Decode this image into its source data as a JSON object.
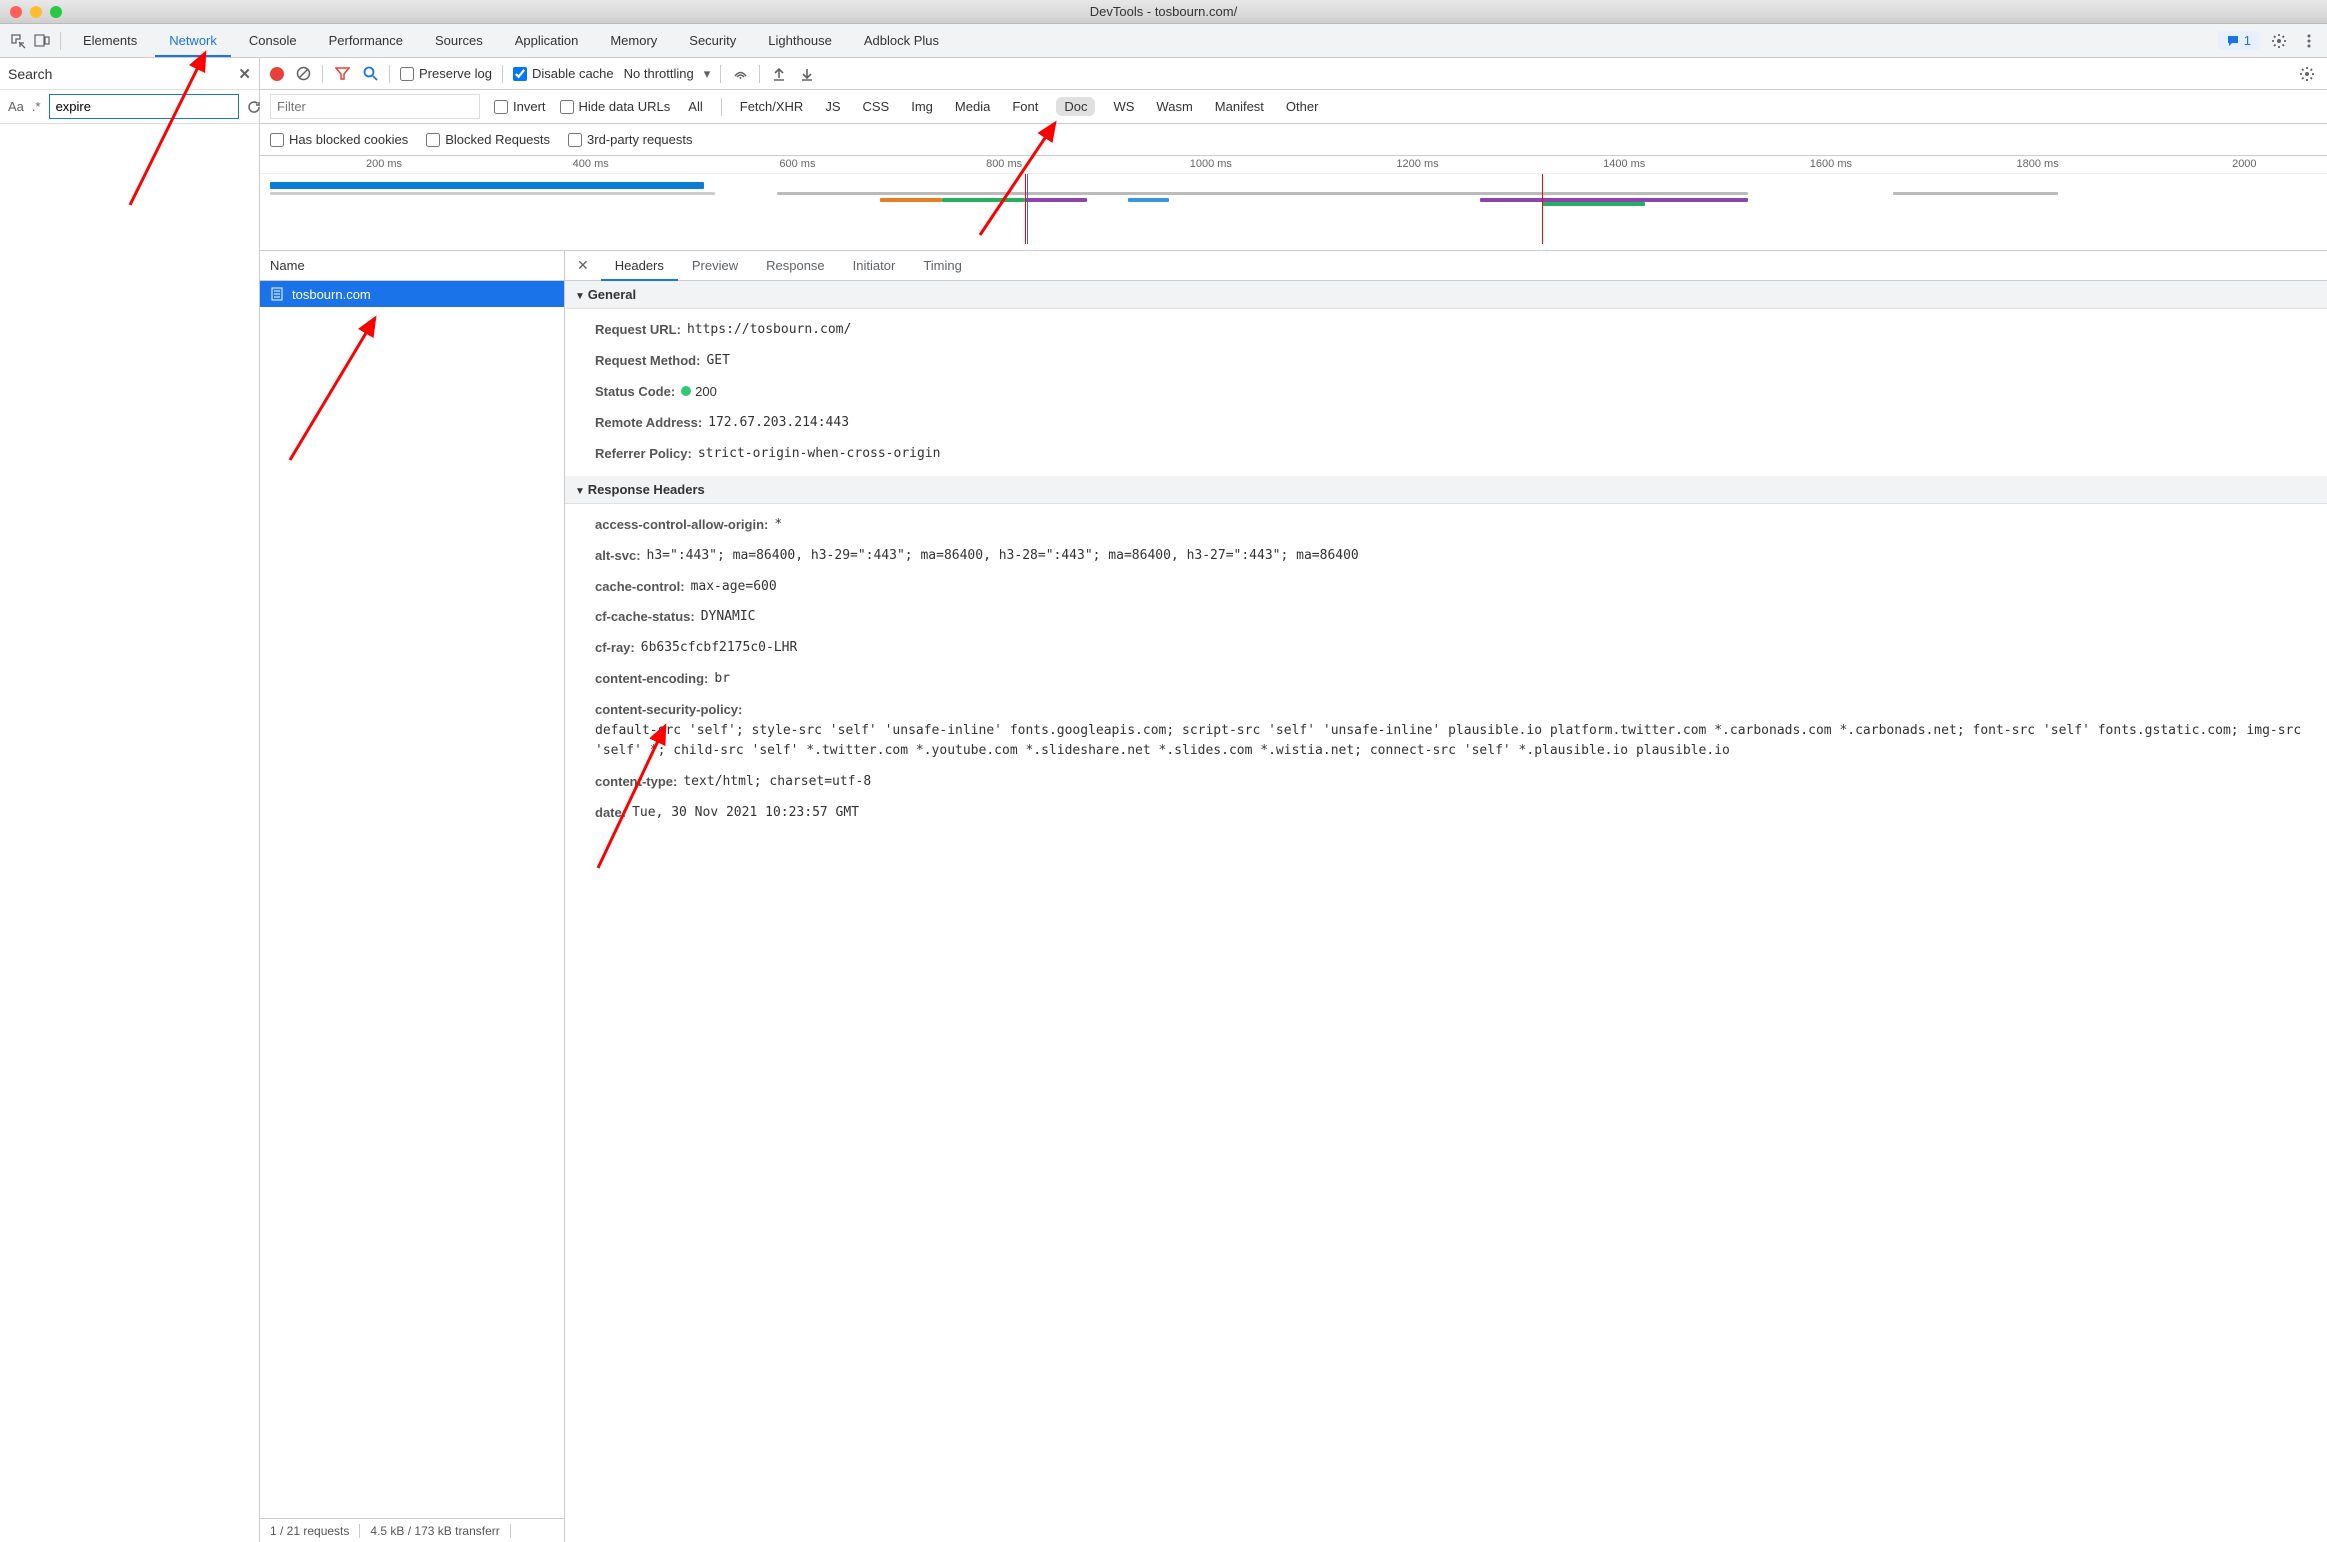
{
  "window": {
    "title": "DevTools - tosbourn.com/"
  },
  "mainTabs": {
    "elements": "Elements",
    "network": "Network",
    "console": "Console",
    "performance": "Performance",
    "sources": "Sources",
    "application": "Application",
    "memory": "Memory",
    "security": "Security",
    "lighthouse": "Lighthouse",
    "adblock": "Adblock Plus"
  },
  "issuesCount": "1",
  "searchPanel": {
    "title": "Search",
    "aa": "Aa",
    "regex": ".*",
    "value": "expire"
  },
  "networkToolbar": {
    "preserveLog": "Preserve log",
    "disableCache": "Disable cache",
    "throttling": "No throttling"
  },
  "filterBar": {
    "placeholder": "Filter",
    "invert": "Invert",
    "hideDataUrls": "Hide data URLs",
    "types": {
      "all": "All",
      "fetchxhr": "Fetch/XHR",
      "js": "JS",
      "css": "CSS",
      "img": "Img",
      "media": "Media",
      "font": "Font",
      "doc": "Doc",
      "ws": "WS",
      "wasm": "Wasm",
      "manifest": "Manifest",
      "other": "Other"
    },
    "hasBlockedCookies": "Has blocked cookies",
    "blockedRequests": "Blocked Requests",
    "thirdParty": "3rd-party requests"
  },
  "timeline": {
    "ticks": [
      "200 ms",
      "400 ms",
      "600 ms",
      "800 ms",
      "1000 ms",
      "1200 ms",
      "1400 ms",
      "1600 ms",
      "1800 ms",
      "2000"
    ]
  },
  "requestList": {
    "headerName": "Name",
    "items": [
      {
        "name": "tosbourn.com"
      }
    ]
  },
  "detailsTabs": {
    "headers": "Headers",
    "preview": "Preview",
    "response": "Response",
    "initiator": "Initiator",
    "timing": "Timing"
  },
  "general": {
    "title": "General",
    "requestUrlLabel": "Request URL:",
    "requestUrlValue": "https://tosbourn.com/",
    "requestMethodLabel": "Request Method:",
    "requestMethodValue": "GET",
    "statusCodeLabel": "Status Code:",
    "statusCodeValue": "200",
    "remoteAddressLabel": "Remote Address:",
    "remoteAddressValue": "172.67.203.214:443",
    "referrerPolicyLabel": "Referrer Policy:",
    "referrerPolicyValue": "strict-origin-when-cross-origin"
  },
  "responseHeaders": {
    "title": "Response Headers",
    "items": [
      {
        "k": "access-control-allow-origin:",
        "v": "*"
      },
      {
        "k": "alt-svc:",
        "v": "h3=\":443\"; ma=86400, h3-29=\":443\"; ma=86400, h3-28=\":443\"; ma=86400, h3-27=\":443\"; ma=86400"
      },
      {
        "k": "cache-control:",
        "v": "max-age=600"
      },
      {
        "k": "cf-cache-status:",
        "v": "DYNAMIC"
      },
      {
        "k": "cf-ray:",
        "v": "6b635cfcbf2175c0-LHR"
      },
      {
        "k": "content-encoding:",
        "v": "br"
      },
      {
        "k": "content-security-policy:",
        "v": "default-src 'self'; style-src 'self' 'unsafe-inline' fonts.googleapis.com; script-src 'self' 'unsafe-inline' plausible.io platform.twitter.com *.carbonads.com *.carbonads.net; font-src 'self' fonts.gstatic.com; img-src 'self' *; child-src 'self' *.twitter.com *.youtube.com *.slideshare.net *.slides.com *.wistia.net; connect-src 'self' *.plausible.io plausible.io"
      },
      {
        "k": "content-type:",
        "v": "text/html; charset=utf-8"
      },
      {
        "k": "date:",
        "v": "Tue, 30 Nov 2021 10:23:57 GMT"
      }
    ]
  },
  "statusBar": {
    "requests": "1 / 21 requests",
    "transfer": "4.5 kB / 173 kB transferr"
  }
}
